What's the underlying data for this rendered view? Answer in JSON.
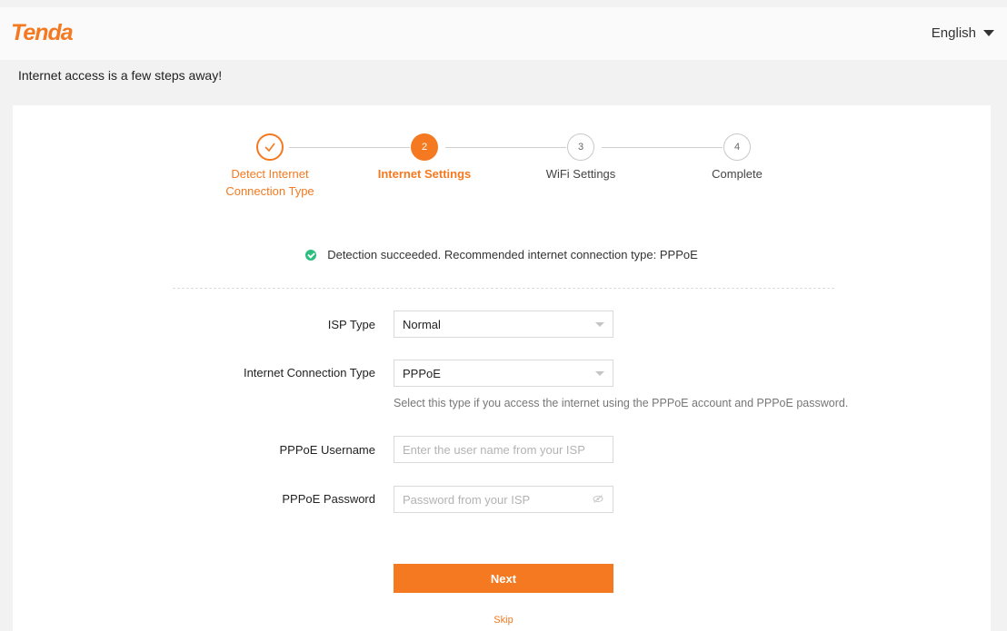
{
  "header": {
    "logo_text": "Tenda",
    "language": "English"
  },
  "tagline": "Internet access is a few steps away!",
  "steps": [
    {
      "number": "",
      "label": "Detect Internet Connection Type",
      "state": "done"
    },
    {
      "number": "2",
      "label": "Internet Settings",
      "state": "active"
    },
    {
      "number": "3",
      "label": "WiFi Settings",
      "state": "idle"
    },
    {
      "number": "4",
      "label": "Complete",
      "state": "idle"
    }
  ],
  "step1_label_lines": [
    "Detect Internet",
    "Connection Type"
  ],
  "status_message": "Detection succeeded. Recommended internet connection type: PPPoE",
  "form": {
    "isp_type_label": "ISP Type",
    "isp_type_value": "Normal",
    "conn_type_label": "Internet Connection Type",
    "conn_type_value": "PPPoE",
    "conn_type_hint": "Select this type if you access the internet using the PPPoE account and PPPoE password.",
    "username_label": "PPPoE Username",
    "username_placeholder": "Enter the user name from your ISP",
    "password_label": "PPPoE Password",
    "password_placeholder": "Password from your ISP"
  },
  "actions": {
    "next_label": "Next",
    "skip_label": "Skip"
  },
  "colors": {
    "accent": "#f47920",
    "success": "#2bbf7f"
  }
}
